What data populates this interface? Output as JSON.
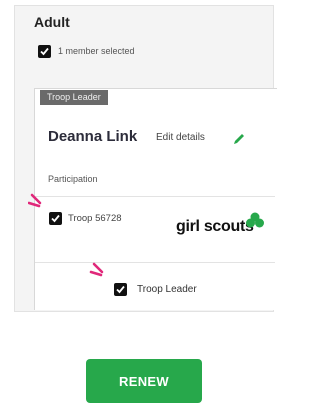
{
  "section": {
    "title": "Adult",
    "member_selected_label": "1 member selected"
  },
  "member": {
    "role_tag": "Troop Leader",
    "name": "Deanna Link",
    "edit_label": "Edit details",
    "participation_label": "Participation",
    "troop_label": "Troop 56728",
    "troop_checked": true,
    "leader_label": "Troop Leader",
    "leader_checked": true,
    "member_checked": true
  },
  "brand": {
    "logo_text": "girl scouts",
    "trefoil_color": "#27a84b"
  },
  "colors": {
    "accent_green": "#27a84b",
    "highlight_pink": "#e0287a"
  },
  "actions": {
    "renew_label": "RENEW"
  }
}
